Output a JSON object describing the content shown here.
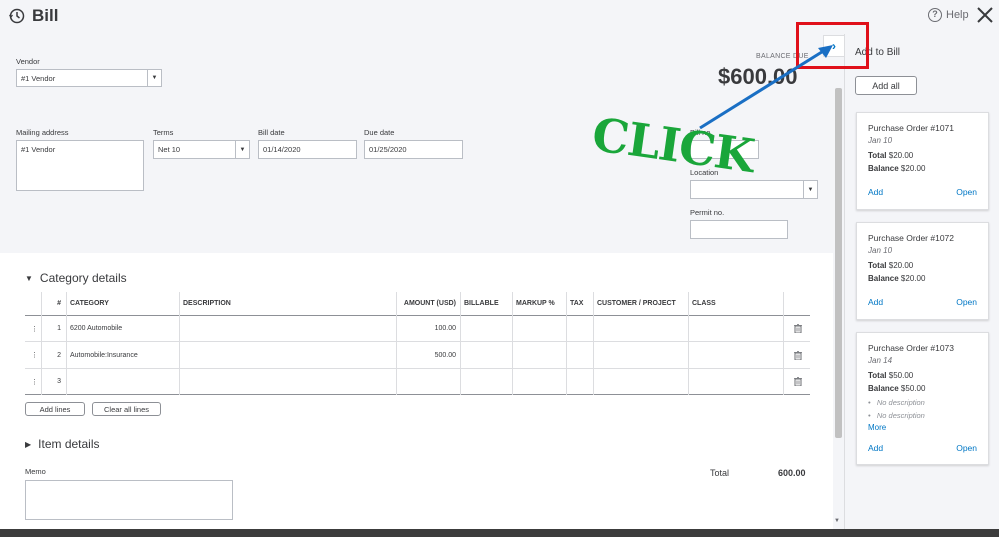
{
  "header": {
    "title": "Bill",
    "help": "Help"
  },
  "form": {
    "vendor_label": "Vendor",
    "vendor_value": "#1 Vendor",
    "mailing_label": "Mailing address",
    "mailing_value": "#1 Vendor",
    "terms_label": "Terms",
    "terms_value": "Net 10",
    "bill_date_label": "Bill date",
    "bill_date_value": "01/14/2020",
    "due_date_label": "Due date",
    "due_date_value": "01/25/2020",
    "bill_no_label": "Bill no.",
    "location_label": "Location",
    "permit_label": "Permit no.",
    "balance_label": "BALANCE DUE",
    "balance_value": "$600.00"
  },
  "category": {
    "title": "Category details",
    "columns": [
      "#",
      "CATEGORY",
      "DESCRIPTION",
      "AMOUNT (USD)",
      "BILLABLE",
      "MARKUP %",
      "TAX",
      "CUSTOMER / PROJECT",
      "CLASS"
    ],
    "rows": [
      {
        "num": "1",
        "category": "6200 Automobile",
        "amount": "100.00"
      },
      {
        "num": "2",
        "category": "Automobile:Insurance",
        "amount": "500.00"
      },
      {
        "num": "3",
        "category": "",
        "amount": ""
      }
    ],
    "add_lines": "Add lines",
    "clear_lines": "Clear all lines"
  },
  "item_details": {
    "title": "Item details"
  },
  "memo_label": "Memo",
  "total": {
    "label": "Total",
    "value": "600.00"
  },
  "panel": {
    "title": "Add to Bill",
    "add_all": "Add all",
    "cards": [
      {
        "title": "Purchase Order #1071",
        "date": "Jan 10",
        "total_label": "Total",
        "total": "$20.00",
        "balance_label": "Balance",
        "balance": "$20.00",
        "add": "Add",
        "open": "Open"
      },
      {
        "title": "Purchase Order #1072",
        "date": "Jan 10",
        "total_label": "Total",
        "total": "$20.00",
        "balance_label": "Balance",
        "balance": "$20.00",
        "add": "Add",
        "open": "Open"
      },
      {
        "title": "Purchase Order #1073",
        "date": "Jan 14",
        "total_label": "Total",
        "total": "$50.00",
        "balance_label": "Balance",
        "balance": "$50.00",
        "desc1": "No description",
        "desc2": "No description",
        "more": "More",
        "add": "Add",
        "open": "Open"
      }
    ]
  },
  "annotation": {
    "text": "CLICK",
    "box_color": "#e0101a",
    "text_color": "#1aa63a",
    "arrow_color": "#1a6fc4"
  },
  "colors": {
    "accent": "#0077c5",
    "background": "#f4f5f8"
  }
}
